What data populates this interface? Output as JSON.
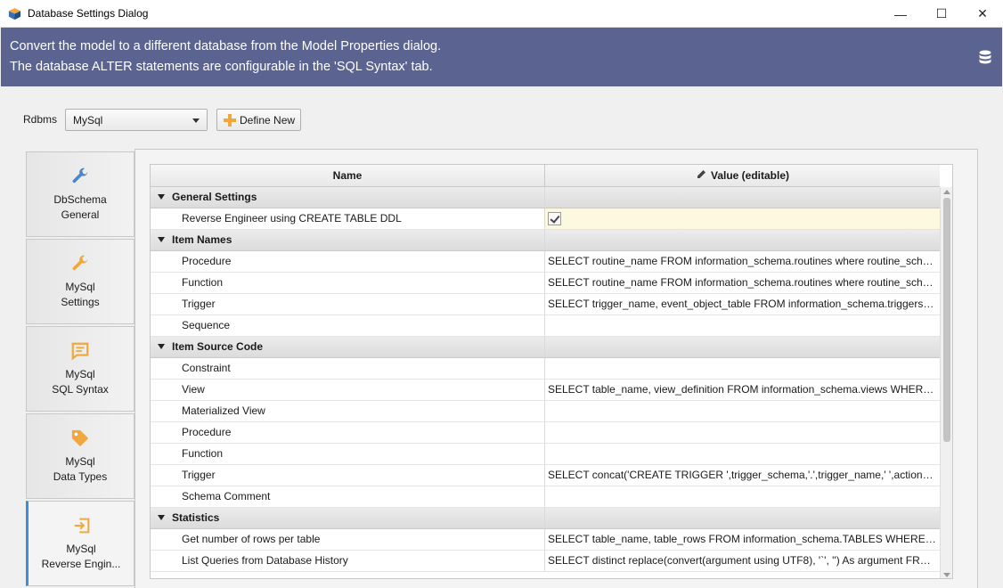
{
  "window": {
    "title": "Database Settings Dialog",
    "minimize": "—",
    "maximize": "☐",
    "close": "✕"
  },
  "banner": {
    "line1": "Convert the model to a different database from the Model Properties dialog.",
    "line2": "The database ALTER statements are configurable in the 'SQL Syntax' tab.",
    "icon": "database-icon"
  },
  "toolbar": {
    "rdbms_label": "Rdbms",
    "rdbms_value": "MySql",
    "define_new_label": "Define New"
  },
  "sidebar": {
    "items": [
      {
        "line1": "DbSchema",
        "line2": "General",
        "icon": "wrench-icon",
        "color": "#4a86c8"
      },
      {
        "line1": "MySql",
        "line2": "Settings",
        "icon": "wrench-icon",
        "color": "#f0a83c"
      },
      {
        "line1": "MySql",
        "line2": "SQL Syntax",
        "icon": "comment-icon",
        "color": "#f0a83c"
      },
      {
        "line1": "MySql",
        "line2": "Data Types",
        "icon": "tag-icon",
        "color": "#f0a83c"
      },
      {
        "line1": "MySql",
        "line2": "Reverse Engin...",
        "icon": "import-icon",
        "color": "#f0a83c",
        "active": true
      }
    ]
  },
  "grid": {
    "col_name": "Name",
    "col_value": "Value (editable)",
    "rows": [
      {
        "type": "section",
        "name": "General Settings",
        "value": ""
      },
      {
        "type": "item",
        "name": "Reverse Engineer using CREATE TABLE DDL",
        "value": "",
        "checkbox": true,
        "checked": true
      },
      {
        "type": "section",
        "name": "Item Names",
        "value": ""
      },
      {
        "type": "item",
        "name": "Procedure",
        "value": "SELECT routine_name FROM information_schema.routines where routine_schem..."
      },
      {
        "type": "item",
        "name": "Function",
        "value": "SELECT routine_name FROM information_schema.routines where routine_schem..."
      },
      {
        "type": "item",
        "name": "Trigger",
        "value": "SELECT trigger_name, event_object_table FROM information_schema.triggers W..."
      },
      {
        "type": "item",
        "name": "Sequence",
        "value": ""
      },
      {
        "type": "section",
        "name": "Item Source Code",
        "value": ""
      },
      {
        "type": "item",
        "name": "Constraint",
        "value": ""
      },
      {
        "type": "item",
        "name": "View",
        "value": "SELECT table_name, view_definition FROM information_schema.views WHERE ta..."
      },
      {
        "type": "item",
        "name": "Materialized View",
        "value": ""
      },
      {
        "type": "item",
        "name": "Procedure",
        "value": ""
      },
      {
        "type": "item",
        "name": "Function",
        "value": ""
      },
      {
        "type": "item",
        "name": "Trigger",
        "value": "SELECT concat('CREATE TRIGGER ',trigger_schema,'.',trigger_name,' ',action_timin..."
      },
      {
        "type": "item",
        "name": "Schema Comment",
        "value": ""
      },
      {
        "type": "section",
        "name": "Statistics",
        "value": ""
      },
      {
        "type": "item",
        "name": "Get number of rows per table",
        "value": "SELECT table_name, table_rows FROM information_schema.TABLES WHERE TABL..."
      },
      {
        "type": "item",
        "name": "List Queries from Database History",
        "value": "SELECT distinct replace(convert(argument using UTF8), '`', '') As argument FROM ..."
      }
    ]
  }
}
